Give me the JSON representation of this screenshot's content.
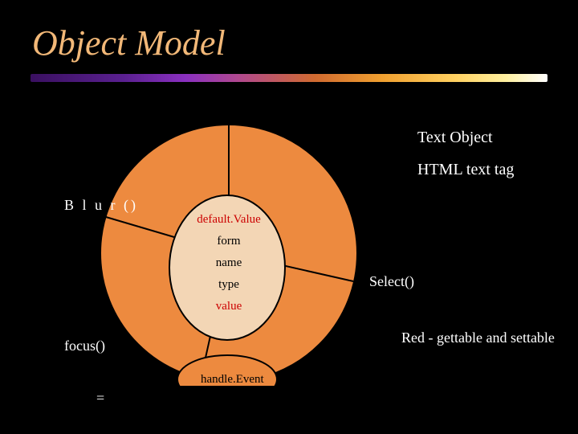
{
  "title": "Object Model",
  "rightLabels": {
    "textObject": "Text Object",
    "htmlTag": "HTML text tag",
    "redNote": "Red - gettable and settable"
  },
  "outerSpokes": {
    "equals": "=",
    "blur": "B l u r ()",
    "focus": "focus()",
    "select": "Select()"
  },
  "centerProps": {
    "defaultValue": "default.Value",
    "form": "form",
    "name": "name",
    "type": "type",
    "value": "value",
    "handleEvent": "handle.Event"
  },
  "chart_data": {
    "type": "pie",
    "title": "Object Model — Text Object wheel",
    "segments_outer_ring": [
      {
        "name": "=",
        "proportion": 0.25
      },
      {
        "name": "Blur()",
        "proportion": 0.25
      },
      {
        "name": "focus()",
        "proportion": 0.25
      },
      {
        "name": "Select()",
        "proportion": 0.25
      }
    ],
    "center_properties": [
      "default.Value",
      "form",
      "name",
      "type",
      "value"
    ],
    "bottom_method": "handle.Event",
    "colors": {
      "fill": "#ED8A3F",
      "stroke": "#000000"
    },
    "annotations": [
      "Text Object",
      "HTML text tag",
      "Red - gettable and settable"
    ]
  }
}
